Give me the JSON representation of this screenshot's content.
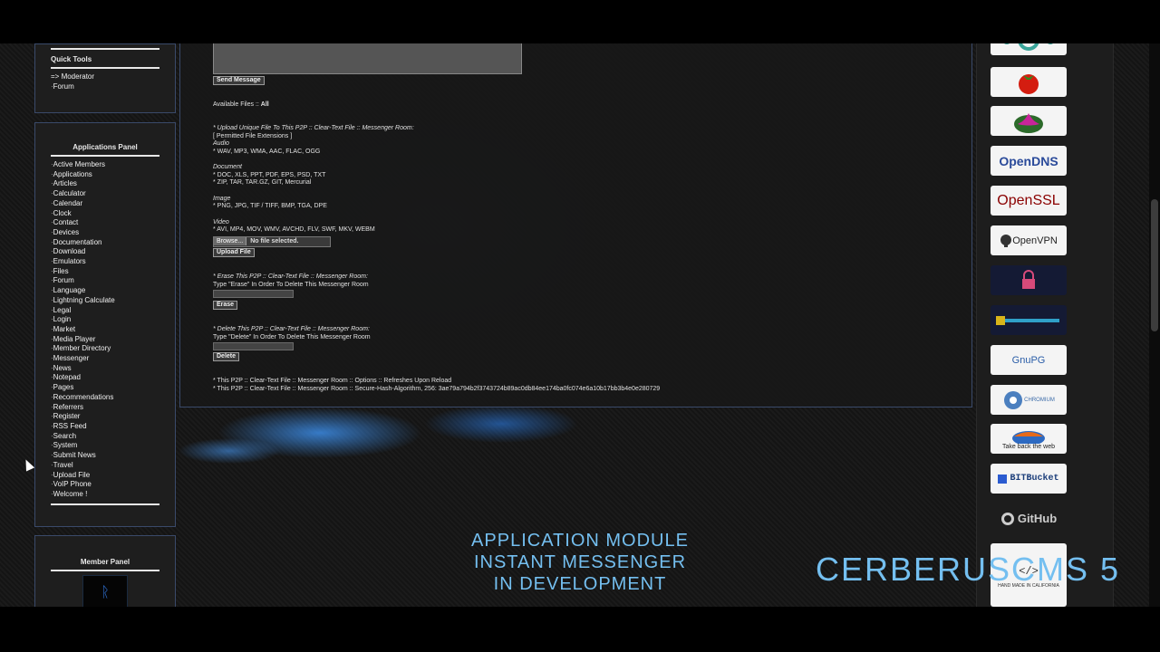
{
  "quick_tools": {
    "title": "Quick Tools",
    "items": [
      "=> Moderator",
      "Forum"
    ]
  },
  "applications_panel": {
    "title": "Applications Panel",
    "items": [
      "Active Members",
      "Applications",
      "Articles",
      "Calculator",
      "Calendar",
      "Clock",
      "Contact",
      "Devices",
      "Documentation",
      "Download",
      "Emulators",
      "Files",
      "Forum",
      "Language",
      "Lightning Calculate",
      "Legal",
      "Login",
      "Market",
      "Media Player",
      "Member Directory",
      "Messenger",
      "News",
      "Notepad",
      "Pages",
      "Recommendations",
      "Referrers",
      "Register",
      "RSS Feed",
      "Search",
      "System",
      "Submit News",
      "Travel",
      "Upload File",
      "VoIP Phone",
      "Welcome !"
    ]
  },
  "member_panel": {
    "title": "Member Panel",
    "avatar_glyph": "ᚱ"
  },
  "main": {
    "send_button": "Send Message",
    "available_files_label": "Available Files ::",
    "available_files_value": "All",
    "upload_heading": "* Upload Unique File To This P2P :: Clear-Text File :: Messenger Room:",
    "permitted": "[ Permitted File Extensions ]",
    "audio_label": "Audio",
    "audio_ext": "* WAV, MP3, WMA, AAC, FLAC, OGG",
    "document_label": "Document",
    "document_ext1": "* DOC, XLS, PPT, PDF, EPS, PSD, TXT",
    "document_ext2": "* ZIP, TAR, TAR.GZ, GIT, Mercurial",
    "image_label": "Image",
    "image_ext": "* PNG, JPG, TIF / TIFF, BMP, TGA, DPE",
    "video_label": "Video",
    "video_ext": "* AVI, MP4, MOV, WMV, AVCHD, FLV, SWF, MKV, WEBM",
    "browse_label": "Browse...",
    "no_file": "No file selected.",
    "upload_button": "Upload File",
    "erase_heading": "* Erase This P2P :: Clear-Text File :: Messenger Room:",
    "erase_instruction": "Type \"Erase\" In Order To Delete This Messenger Room",
    "erase_button": "Erase",
    "delete_heading": "* Delete This P2P :: Clear-Text File :: Messenger Room:",
    "delete_instruction": "Type \"Delete\" In Order To Delete This Messenger Room",
    "delete_button": "Delete",
    "footer1": "* This P2P :: Clear-Text File :: Messenger Room :: Options :: Refreshes Upon Reload",
    "footer2": "* This P2P :: Clear-Text File :: Messenger Room :: Secure-Hash-Algorithm, 256: 3ae79a794b2f3743724b89ac0db84ee174ba0fc074e6a10b17bb3b4e0e280729"
  },
  "right_badges": {
    "opendns": "OpenDNS",
    "openssl": "OpenSSL",
    "openvpn": "OpenVPN",
    "gnupg": "GnuPG",
    "chromium": "CHROMIUM",
    "web": "Take back the web",
    "bitbucket": "BITBucket",
    "github": "GitHub",
    "handmade": "HAND MADE IN CALIFORNIA"
  },
  "overlay": {
    "line1": "APPLICATION MODULE",
    "line2": "INSTANT MESSENGER",
    "line3": "IN DEVELOPMENT",
    "brand": "CERBERUSCMS 5"
  },
  "colors": {
    "accent": "#74bff0",
    "panel_border": "#3a4a6a",
    "background": "#161616"
  }
}
